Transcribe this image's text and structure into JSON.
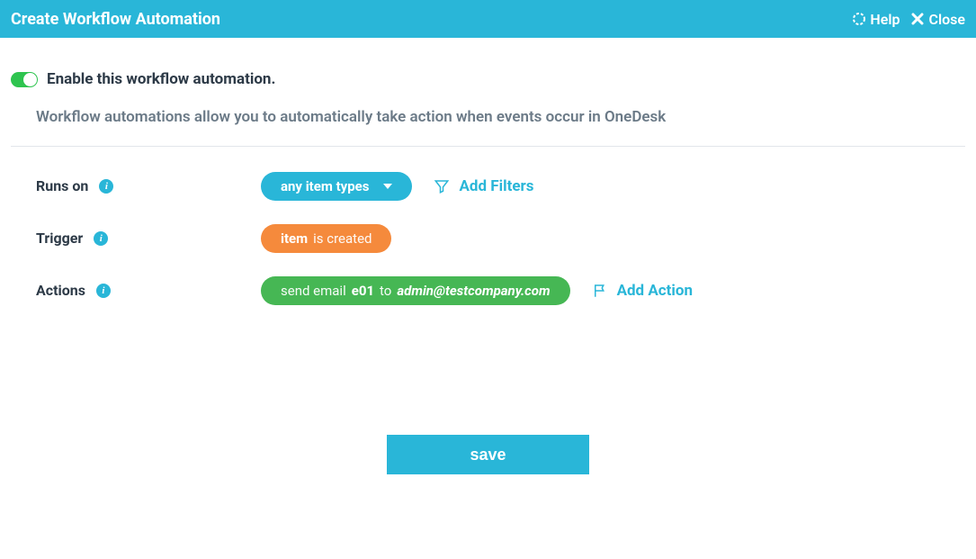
{
  "header": {
    "title": "Create Workflow Automation",
    "help": "Help",
    "close": "Close"
  },
  "enable": {
    "label": "Enable this workflow automation.",
    "enabled": true
  },
  "description": "Workflow automations allow you to automatically take action when events occur in OneDesk",
  "runsOn": {
    "label": "Runs on",
    "selected": "any item types",
    "addFilters": "Add Filters"
  },
  "trigger": {
    "label": "Trigger",
    "subject": "item",
    "condition": "is created"
  },
  "actions": {
    "label": "Actions",
    "actionPrefix": "send email",
    "templateId": "e01",
    "toWord": "to",
    "recipient": "admin@testcompany.com",
    "addAction": "Add Action"
  },
  "save": "save"
}
